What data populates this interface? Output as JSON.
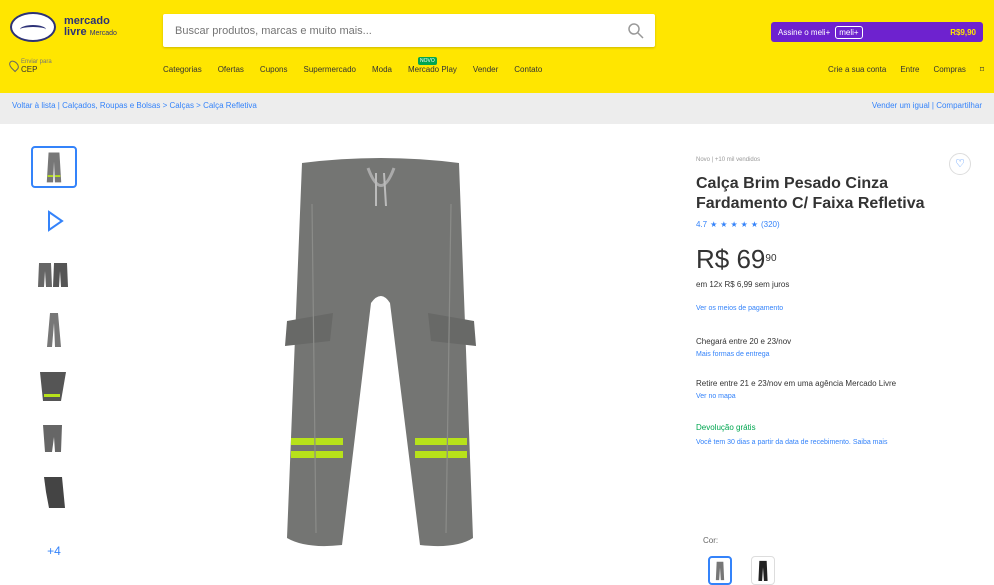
{
  "header": {
    "logo": {
      "brand": "mercado",
      "brand_2": "livre",
      "tagline": "Mercado"
    },
    "search": {
      "placeholder": "Buscar produtos, marcas e muito mais..."
    },
    "promo": {
      "text": "Assine o meli+",
      "pill": "meli+",
      "price": "R$9,90"
    },
    "cep": {
      "label": "Enviar para",
      "value": "CEP"
    },
    "nav": [
      "Categorias",
      "Ofertas",
      "Cupons",
      "Supermercado",
      "Moda",
      "Mercado Play",
      "Vender",
      "Contato"
    ],
    "badge": "NOVO",
    "account": [
      "Crie a sua conta",
      "Entre",
      "Compras"
    ]
  },
  "breadcrumb": {
    "left": "Voltar à lista  |  Calçados, Roupas e Bolsas > Calças > Calça Refletiva",
    "right": "Vender um igual  |  Compartilhar"
  },
  "product": {
    "condition": "Novo  |  +10 mil vendidos",
    "title": "Calça Brim Pesado Cinza Fardamento C/ Faixa Refletiva",
    "rating": "4.7",
    "rating_count": "(320)",
    "price": "R$ 69",
    "price_cents": "90",
    "installments": "em 12x R$ 6,99",
    "installment_extra": " sem juros",
    "payment_link": "Ver os meios de pagamento",
    "delivery_title": "Chegará entre 20 e 23/nov",
    "delivery_link": "Mais formas de entrega",
    "pickup_text": "Retire entre 21 e 23/nov em uma agência Mercado Livre",
    "map_link": "Ver no mapa",
    "returns_title": "Devolução grátis",
    "returns_text": "Você tem 30 dias a partir da data de recebimento. ",
    "returns_link": "Saiba mais",
    "color_label": "Cor:",
    "more_thumbs": "+4",
    "heart": "♡"
  },
  "colors": {
    "header_yellow": "#ffe600",
    "link_blue": "#3483fa",
    "success_green": "#00a650",
    "reflective": "#b7e21a",
    "pants_gray": "#737371",
    "promo_purple": "#6e22cf"
  }
}
